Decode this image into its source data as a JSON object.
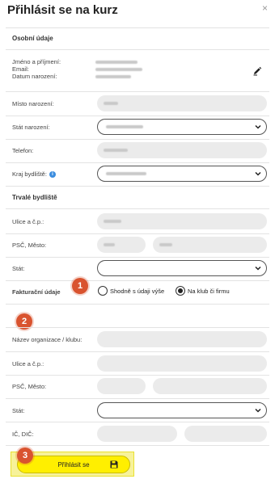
{
  "dialog": {
    "title": "Přihlásit se na kurz",
    "close_symbol": "×"
  },
  "personal": {
    "section_title": "Osobní údaje",
    "name_label": "Jméno a příjmení:",
    "email_label": "Email:",
    "dob_label": "Datum narození:",
    "edit_icon": "pencil-icon"
  },
  "fields": {
    "birthplace_label": "Místo narození:",
    "birth_country_label": "Stát narození:",
    "phone_label": "Telefon:",
    "region_label": "Kraj bydliště:",
    "region_info_symbol": "i"
  },
  "permanent": {
    "section_title": "Trvalé bydliště",
    "street_label": "Ulice a č.p.:",
    "zip_city_label": "PSČ, Město:",
    "country_label": "Stát:"
  },
  "billing": {
    "label": "Fakturační údaje",
    "option_same": "Shodně s údaji výše",
    "option_club": "Na klub či firmu",
    "selected": "club"
  },
  "organization": {
    "name_label": "Název organizace / klubu:",
    "street_label": "Ulice a č.p.:",
    "zip_city_label": "PSČ, Město:",
    "country_label": "Stát:",
    "ico_dic_label": "IČ, DIČ:"
  },
  "submit": {
    "label": "Přihlásit se",
    "icon": "save-icon"
  },
  "badges": [
    "1",
    "2",
    "3"
  ],
  "colors": {
    "badge": "#d9532f",
    "submit": "#ffef00",
    "highlight": "#f7f29a",
    "info": "#3c8dde"
  }
}
